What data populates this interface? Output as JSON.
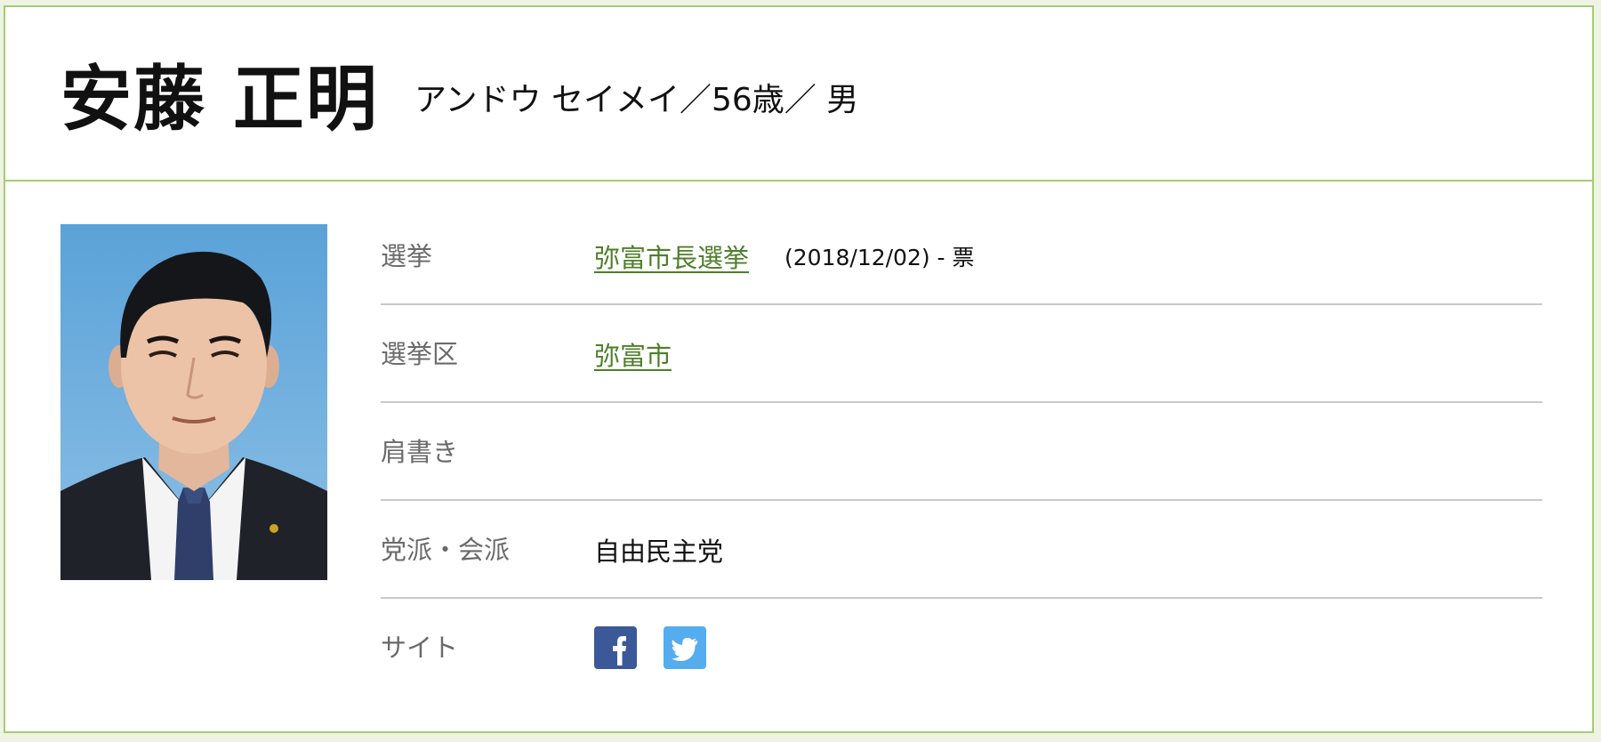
{
  "candidate": {
    "name": "安藤 正明",
    "kana_age_gender": "アンドウ セイメイ／56歳／ 男"
  },
  "details": {
    "election": {
      "label": "選挙",
      "link_text": "弥富市長選挙",
      "date_votes": "(2018/12/02) - 票"
    },
    "district": {
      "label": "選挙区",
      "link_text": "弥富市"
    },
    "title": {
      "label": "肩書き",
      "value": ""
    },
    "party": {
      "label": "党派・会派",
      "value": "自由民主党"
    },
    "site": {
      "label": "サイト",
      "icons": [
        "facebook-icon",
        "twitter-icon"
      ]
    }
  },
  "colors": {
    "border_accent": "#a6cc76",
    "link": "#4f7f2a",
    "facebook": "#3b5998",
    "twitter": "#55acee"
  }
}
